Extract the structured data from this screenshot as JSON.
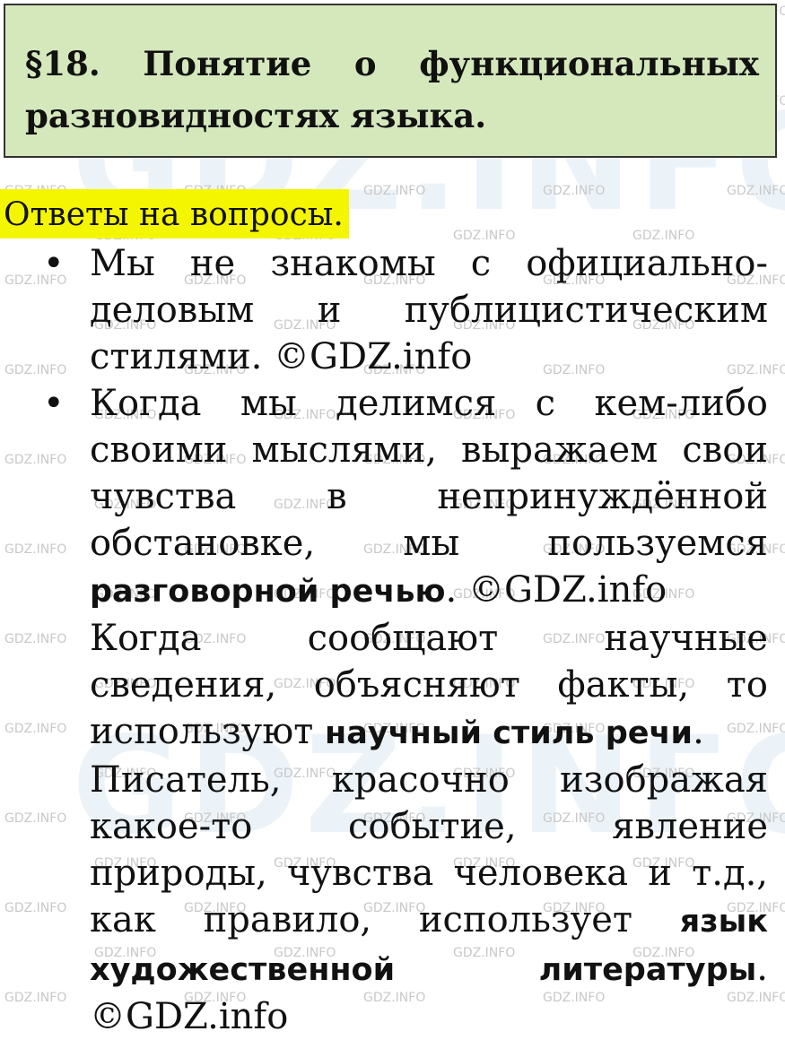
{
  "watermark": {
    "small": "GDZ.INFO",
    "big": "GDZ.INFO"
  },
  "title": "§18. Понятие о функциональных разновидностях языка.",
  "answers_heading": "Ответы на вопросы.",
  "answers": [
    {
      "bullet": true,
      "text": "Мы не знакомы с официально-деловым и публицистическим стилями. ©GDZ.info"
    },
    {
      "bullet": true,
      "before": "Когда мы делимся с кем-либо своими мыслями, выражаем свои чувства в непринуждённой обстановке, мы пользуемся ",
      "bold": "разговорной речью",
      "after": ". ©GDZ.info"
    },
    {
      "bullet": false,
      "before": "Когда сообщают научные сведения, объясняют факты, то используют ",
      "bold": "научный стиль речи",
      "after": "."
    },
    {
      "bullet": false,
      "before": "Писатель, красочно изображая какое-то событие, явление природы, чувства человека и т.д., как правило, использует ",
      "bold": "язык художественной литературы",
      "after": ". ©GDZ.info"
    }
  ]
}
